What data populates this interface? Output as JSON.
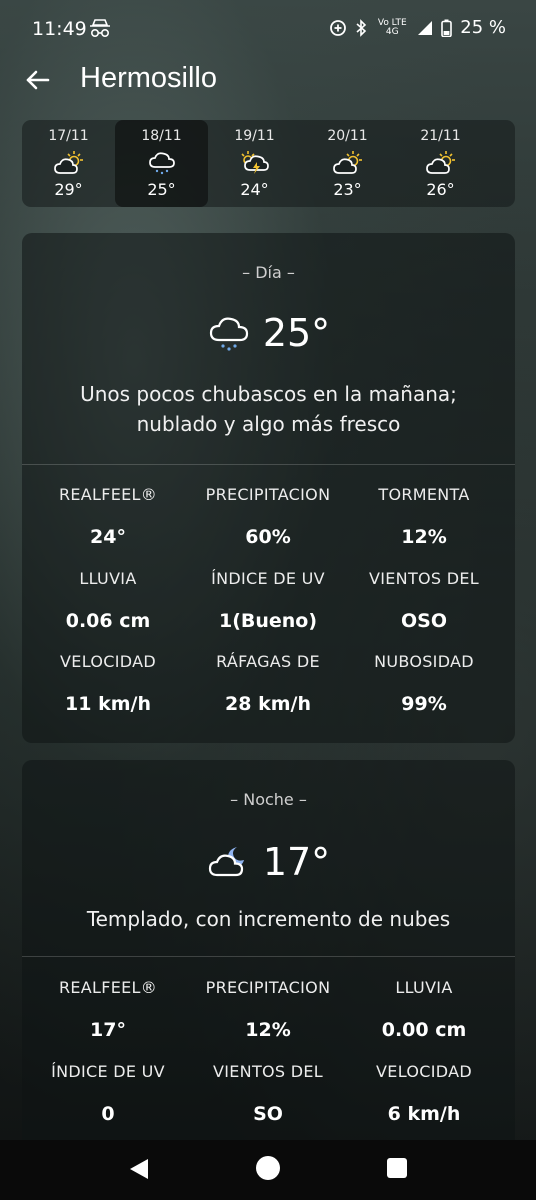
{
  "status": {
    "time": "11:49",
    "network": "Vo LTE 4G",
    "battery": "25 %"
  },
  "header": {
    "city": "Hermosillo"
  },
  "forecast": [
    {
      "date": "17/11",
      "icon": "partly-sunny-cloud-icon",
      "temp": "29°"
    },
    {
      "date": "18/11",
      "icon": "rain-cloud-icon",
      "temp": "25°"
    },
    {
      "date": "19/11",
      "icon": "thunderstorm-sun-icon",
      "temp": "24°"
    },
    {
      "date": "20/11",
      "icon": "partly-sunny-cloud-icon",
      "temp": "23°"
    },
    {
      "date": "21/11",
      "icon": "partly-sunny-cloud-icon",
      "temp": "26°"
    }
  ],
  "day": {
    "label": "Día",
    "icon": "rain-cloud-icon",
    "temp": "25°",
    "desc_line1": "Unos pocos chubascos en la mañana;",
    "desc_line2": "nublado y algo más fresco",
    "stats": [
      {
        "label": "REALFEEL®",
        "value": "24°"
      },
      {
        "label": "PRECIPITACION",
        "value": "60%"
      },
      {
        "label": "TORMENTA",
        "value": "12%"
      },
      {
        "label": "LLUVIA",
        "value": "0.06 cm"
      },
      {
        "label": "ÍNDICE DE UV",
        "value": "1(Bueno)"
      },
      {
        "label": "VIENTOS DEL",
        "value": "OSO"
      },
      {
        "label": "VELOCIDAD",
        "value": "11 km/h"
      },
      {
        "label": "RÁFAGAS DE",
        "value": "28 km/h"
      },
      {
        "label": "NUBOSIDAD",
        "value": "99%"
      }
    ]
  },
  "night": {
    "label": "Noche",
    "icon": "moon-cloud-icon",
    "temp": "17°",
    "desc": "Templado, con incremento de nubes",
    "stats": [
      {
        "label": "REALFEEL®",
        "value": "17°"
      },
      {
        "label": "PRECIPITACION",
        "value": "12%"
      },
      {
        "label": "LLUVIA",
        "value": "0.00 cm"
      },
      {
        "label": "ÍNDICE DE UV",
        "value": "0"
      },
      {
        "label": "VIENTOS DEL",
        "value": "SO"
      },
      {
        "label": "VELOCIDAD",
        "value": "6 km/h"
      }
    ]
  },
  "colors": {
    "sun": "#f2c230",
    "rain": "#6fa8e8",
    "moon": "#8fb3ef"
  }
}
